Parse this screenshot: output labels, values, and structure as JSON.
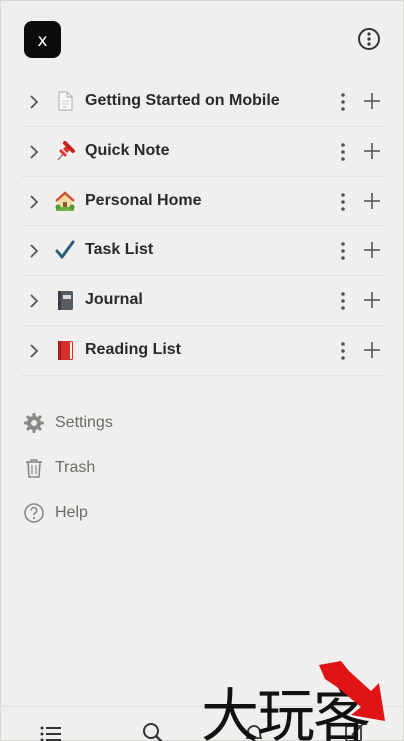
{
  "app": {
    "badge_letter": "x"
  },
  "pages": [
    {
      "icon": "page-icon",
      "label": "Getting Started on Mobile"
    },
    {
      "icon": "pushpin-emoji",
      "label": "Quick Note"
    },
    {
      "icon": "house-garden-emoji",
      "label": "Personal Home"
    },
    {
      "icon": "check-mark-emoji",
      "label": "Task List"
    },
    {
      "icon": "notebook-emoji",
      "label": "Journal"
    },
    {
      "icon": "red-book-emoji",
      "label": "Reading List"
    }
  ],
  "utility": [
    {
      "icon": "gear-icon",
      "label": "Settings"
    },
    {
      "icon": "trash-icon",
      "label": "Trash"
    },
    {
      "icon": "help-icon",
      "label": "Help"
    }
  ],
  "bottom_nav": [
    "list-icon",
    "search-icon",
    "bell-icon",
    "compose-icon"
  ],
  "watermark": {
    "text": "大玩客"
  },
  "colors": {
    "background": "#f0efed",
    "text": "#2b2b2b",
    "muted": "#6c6b68",
    "badge": "#0c0c0c"
  }
}
